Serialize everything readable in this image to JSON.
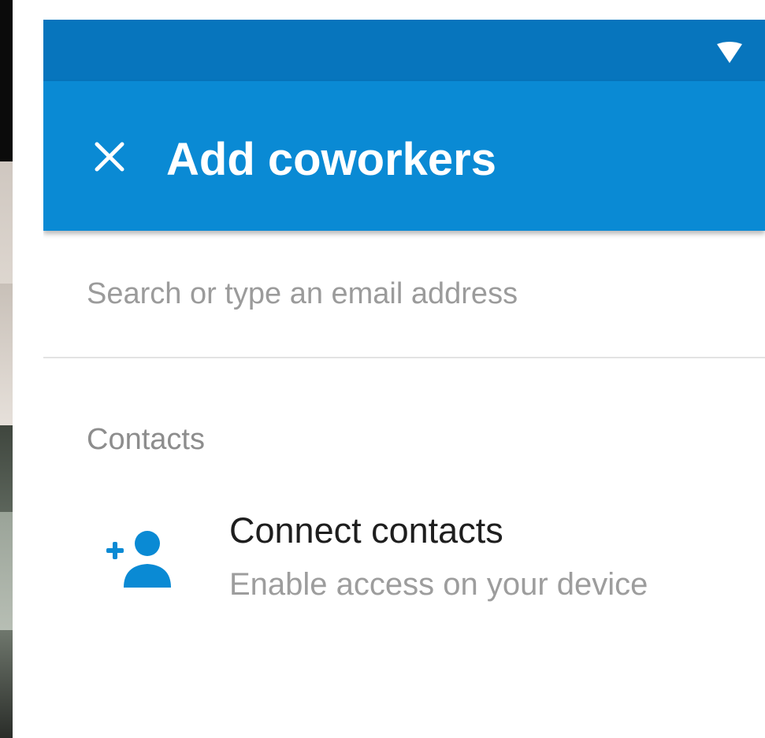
{
  "header": {
    "title": "Add coworkers",
    "close_icon": "close-icon"
  },
  "status_bar": {
    "wifi_icon": "wifi-icon"
  },
  "search": {
    "placeholder": "Search or type an email address",
    "value": ""
  },
  "contacts_section": {
    "header": "Contacts",
    "items": [
      {
        "icon": "add-person-icon",
        "title": "Connect contacts",
        "subtitle": "Enable access on your device"
      }
    ]
  },
  "colors": {
    "status_bar": "#0775bd",
    "app_bar": "#0a8ad4",
    "accent_icon": "#0a8ad4"
  }
}
